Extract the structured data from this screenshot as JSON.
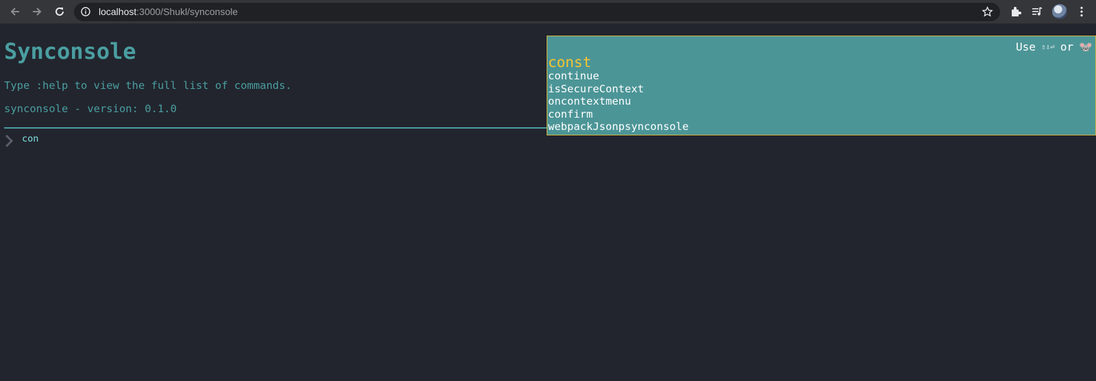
{
  "browser": {
    "url_host": "localhost",
    "url_rest": ":3000/Shukl/synconsole"
  },
  "app": {
    "title": "Synconsole",
    "help_text": "Type :help to view the full list of commands.",
    "version_text": "synconsole - version: 0.1.0",
    "input_value": "con"
  },
  "autocomplete": {
    "hint_use": "Use",
    "hint_keys": "⇧⇩⏎",
    "hint_or": "or",
    "hint_mouse": "🐭",
    "items": [
      "const",
      "continue",
      "isSecureContext",
      "oncontextmenu",
      "confirm",
      "webpackJsonpsynconsole"
    ],
    "selected_index": 0
  },
  "colors": {
    "accent": "#4a9ea0",
    "background": "#22252e",
    "autocomplete_bg": "#4c9597",
    "selected": "#f4c430"
  }
}
